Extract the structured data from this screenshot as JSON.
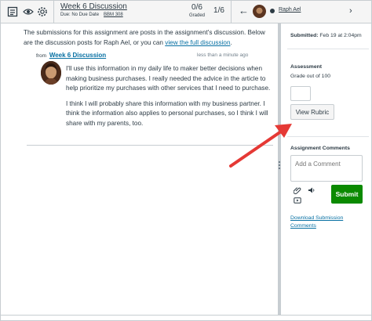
{
  "toolbar": {
    "icons": [
      "gradebook-icon",
      "eye-icon",
      "gear-icon"
    ],
    "assignment_title": "Week 6 Discussion",
    "due_text": "Due: No Due Date",
    "course_code": "BBM 308",
    "graded_count": "0/6",
    "graded_label": "Graded",
    "student_position": "1/6",
    "student_name": "Raph Ael"
  },
  "main": {
    "intro_text": "The submissions for this assignment are posts in the assignment's discussion. Below are the discussion posts for Raph Ael, or you can",
    "intro_link": "view the full discussion",
    "intro_end": ".",
    "from_label": "from",
    "from_link": "Week 6 Discussion",
    "post_time": "less than a minute ago",
    "post_paragraph_1": "I'll use this information in my daily life to maker better decisions when making business purchases. I really needed the advice in the article to help prioritize my purchases with other services that I need to purchase.",
    "post_paragraph_2": "I think I will probably share this information with my business partner. I think the information also applies to personal purchases, so I think I will share with my parents, too."
  },
  "right_panel": {
    "submitted_label": "Submitted:",
    "submitted_date": "Feb 19 at 2:04pm",
    "assessment_heading": "Assessment",
    "grade_out_of": "Grade out of 100",
    "grade_value": "",
    "view_rubric": "View Rubric",
    "comments_heading": "Assignment Comments",
    "comment_placeholder": "Add a Comment",
    "submit_label": "Submit",
    "download_link": "Download Submission Comments"
  },
  "colors": {
    "link": "#0770a3",
    "submit_green": "#0b8a00",
    "annotation_arrow": "#e53935",
    "toolbar_bg": "#f5f5f5"
  }
}
